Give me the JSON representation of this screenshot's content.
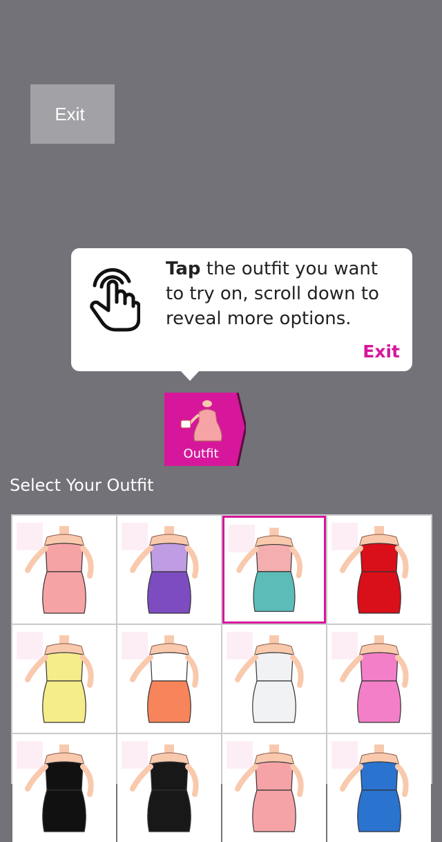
{
  "top_exit_label": "Exit",
  "tooltip": {
    "bold": "Tap",
    "text": " the outfit you want to try on, scroll down to reveal more options.",
    "exit_label": "Exit"
  },
  "outfit_tab": {
    "label": "Outfit"
  },
  "section_title": "Select Your Outfit",
  "outfits": [
    {
      "name": "pink-dress",
      "top": "#f6a3a6",
      "bottom": "#f6a3a6"
    },
    {
      "name": "lavender-top-purple-skirt",
      "top": "#bf9ce3",
      "bottom": "#7d4cc1"
    },
    {
      "name": "pink-croptop-teal-pants",
      "top": "#f5aeb0",
      "bottom": "#5bbcb8"
    },
    {
      "name": "red-dress-purple-boa",
      "top": "#d90f1a",
      "bottom": "#d90f1a"
    },
    {
      "name": "yellow-dress",
      "top": "#f5ec8a",
      "bottom": "#f5ec8a"
    },
    {
      "name": "white-blouse-orange-skirt",
      "top": "#ffffff",
      "bottom": "#f7845a"
    },
    {
      "name": "white-gown",
      "top": "#f1f2f4",
      "bottom": "#f1f2f4"
    },
    {
      "name": "pink-tank-skirt",
      "top": "#f27fc7",
      "bottom": "#f27fc7"
    },
    {
      "name": "black-bra",
      "top": "#111111",
      "bottom": "#111111"
    },
    {
      "name": "black-blazer",
      "top": "#181818",
      "bottom": "#181818"
    },
    {
      "name": "pink-bikini",
      "top": "#f5a3a7",
      "bottom": "#f5a3a7"
    },
    {
      "name": "blue-top",
      "top": "#2a73cf",
      "bottom": "#2a73cf"
    }
  ],
  "colors": {
    "accent": "#d6179b",
    "background": "#737278",
    "skin": "#f9c9ad"
  }
}
